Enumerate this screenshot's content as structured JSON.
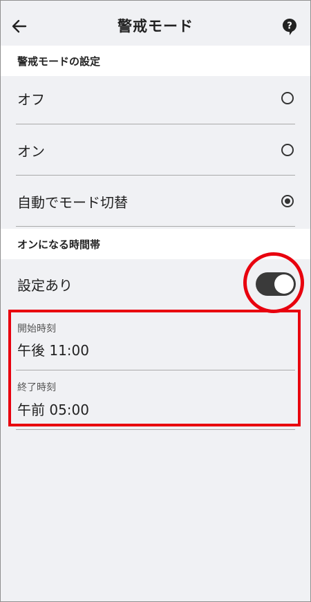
{
  "header": {
    "title": "警戒モード",
    "back_icon": "arrow-left-icon",
    "help_icon": "help-bubble-icon"
  },
  "mode_section": {
    "heading": "警戒モードの設定",
    "options": [
      {
        "label": "オフ",
        "selected": false
      },
      {
        "label": "オン",
        "selected": false
      },
      {
        "label": "自動でモード切替",
        "selected": true
      }
    ]
  },
  "schedule_section": {
    "heading": "オンになる時間帯",
    "setting_label": "設定あり",
    "setting_enabled": true,
    "start": {
      "label": "開始時刻",
      "value": "午後 11:00"
    },
    "end": {
      "label": "終了時刻",
      "value": "午前 05:00"
    }
  },
  "highlight_color": "#e8000e"
}
